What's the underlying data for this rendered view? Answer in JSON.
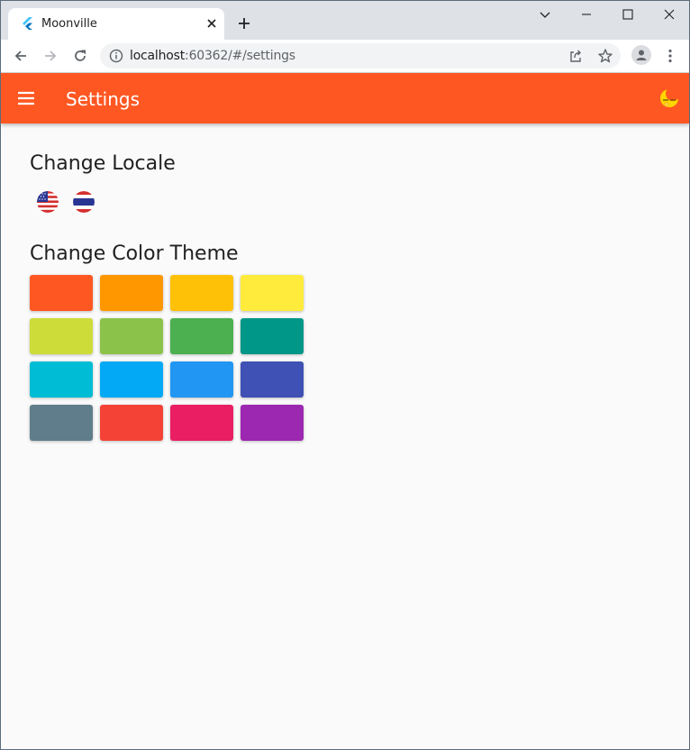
{
  "browser": {
    "tab_title": "Moonville",
    "url_host": "localhost",
    "url_path": ":60362/#/settings"
  },
  "appbar": {
    "title": "Settings",
    "color": "#ff5722"
  },
  "locale": {
    "heading": "Change Locale",
    "flags": [
      "us-flag-icon",
      "thai-flag-icon"
    ]
  },
  "theme": {
    "heading": "Change Color Theme",
    "swatches": [
      "#ff5722",
      "#ff9800",
      "#ffc107",
      "#ffeb3b",
      "#cddc39",
      "#8bc34a",
      "#4caf50",
      "#009688",
      "#00bcd4",
      "#03a9f4",
      "#2196f3",
      "#3f51b5",
      "#607d8b",
      "#f44336",
      "#e91e63",
      "#9c27b0"
    ]
  }
}
